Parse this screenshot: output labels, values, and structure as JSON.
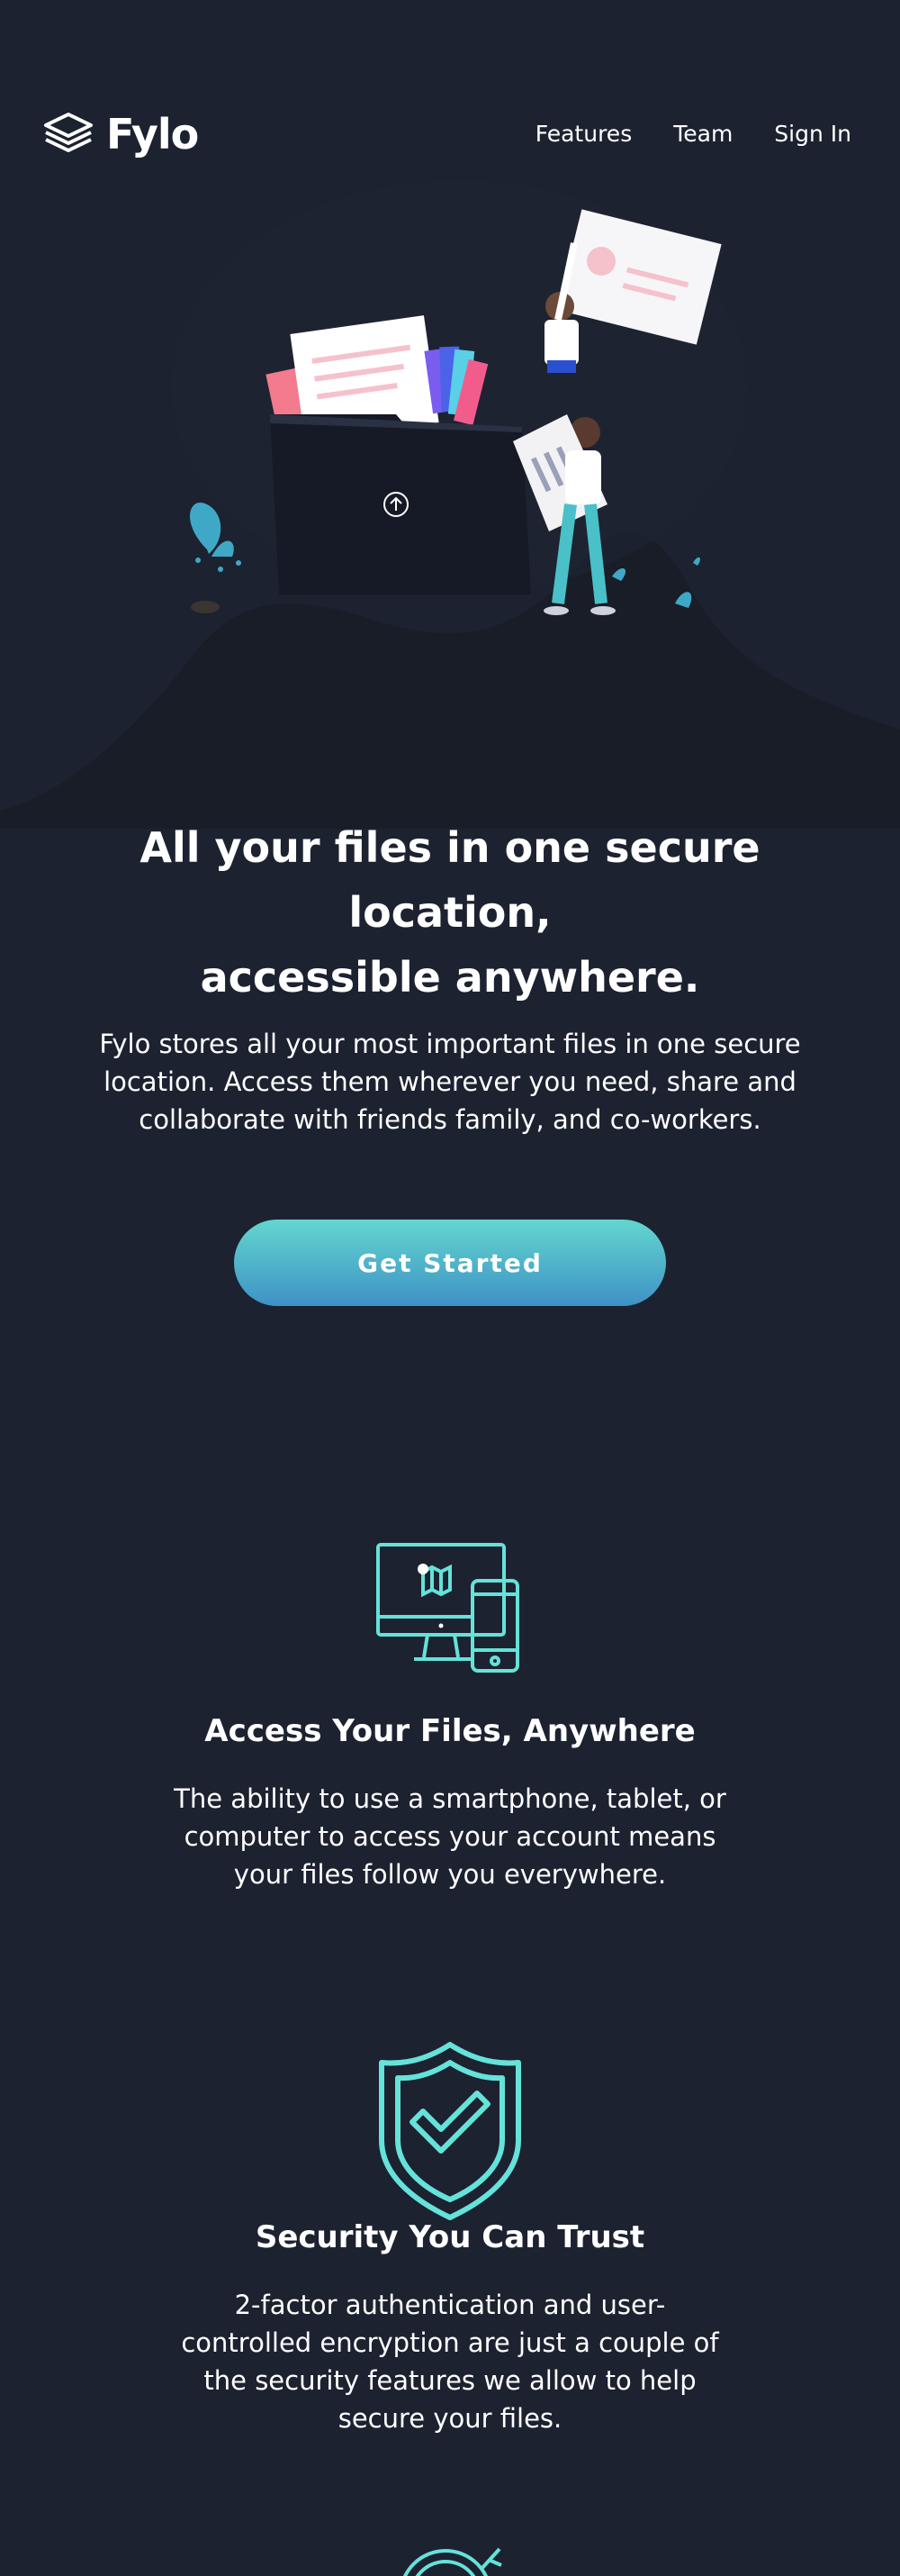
{
  "brand": {
    "name": "Fylo",
    "logo_icon": "stack-layers-icon"
  },
  "nav": {
    "items": [
      {
        "label": "Features"
      },
      {
        "label": "Team"
      },
      {
        "label": "Sign In"
      }
    ]
  },
  "hero": {
    "title_line1": "All your files in one secure location,",
    "title_line2": "accessible anywhere.",
    "description": "Fylo stores all your most important files in one secure location. Access them wherever you need, share and collaborate with friends family, and co-workers.",
    "cta_label": "Get Started",
    "illustration": "file-folder-illustration"
  },
  "features": [
    {
      "icon": "devices-icon",
      "title": "Access Your Files, Anywhere",
      "description": "The ability to use a smartphone, tablet, or computer to access your account means your files follow you everywhere."
    },
    {
      "icon": "shield-check-icon",
      "title": "Security You Can Trust",
      "description": "2-factor authentication and user-controlled encryption are just a couple of the security features we allow to help secure your files."
    }
  ],
  "colors": {
    "background": "#1c2230",
    "curve_background": "#181d28",
    "accent_teal": "#65e2d9",
    "cta_gradient_top": "#63d6cf",
    "cta_gradient_bottom": "#3e92c5"
  }
}
